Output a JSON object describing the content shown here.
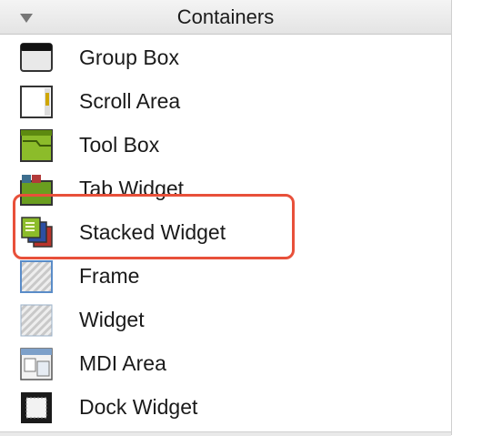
{
  "header": {
    "title": "Containers"
  },
  "items": [
    {
      "label": "Group Box",
      "icon": "group-box-icon"
    },
    {
      "label": "Scroll Area",
      "icon": "scroll-area-icon"
    },
    {
      "label": "Tool Box",
      "icon": "tool-box-icon"
    },
    {
      "label": "Tab Widget",
      "icon": "tab-widget-icon"
    },
    {
      "label": "Stacked Widget",
      "icon": "stacked-widget-icon"
    },
    {
      "label": "Frame",
      "icon": "frame-icon"
    },
    {
      "label": "Widget",
      "icon": "widget-icon"
    },
    {
      "label": "MDI Area",
      "icon": "mdi-area-icon"
    },
    {
      "label": "Dock Widget",
      "icon": "dock-widget-icon"
    }
  ],
  "highlight": {
    "target": "Stacked Widget",
    "color": "#e8503a"
  }
}
